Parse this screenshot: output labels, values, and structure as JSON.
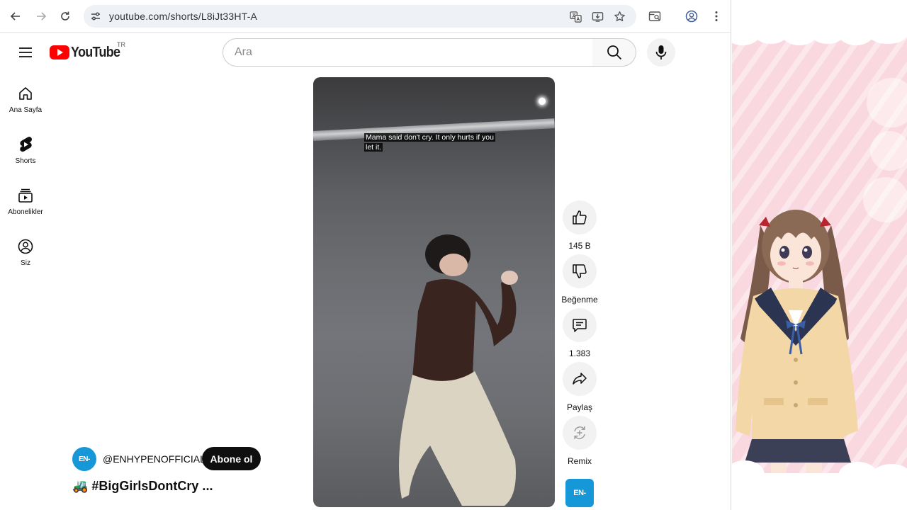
{
  "browser": {
    "url": "youtube.com/shorts/L8iJt33HT-A"
  },
  "header": {
    "logo_text": "YouTube",
    "country_code": "TR",
    "search_placeholder": "Ara"
  },
  "sidebar": {
    "items": [
      {
        "label": "Ana Sayfa",
        "icon": "home-icon"
      },
      {
        "label": "Shorts",
        "icon": "shorts-icon"
      },
      {
        "label": "Abonelikler",
        "icon": "subscriptions-icon"
      },
      {
        "label": "Siz",
        "icon": "you-icon"
      }
    ]
  },
  "video": {
    "caption": "Mama said don't cry. It only hurts if you let it."
  },
  "actions": {
    "like_count": "145 B",
    "dislike_label": "Beğenme",
    "comment_count": "1.383",
    "share_label": "Paylaş",
    "remix_label": "Remix"
  },
  "channel": {
    "avatar_text": "EN-",
    "name": "@ENHYPENOFFICIAL",
    "subscribe_label": "Abone ol",
    "title": "🚜 #BigGirlsDontCry ..."
  },
  "colors": {
    "youtube_red": "#ff0000",
    "channel_blue": "#1597d8",
    "deco_pink": "#f9d9df"
  }
}
